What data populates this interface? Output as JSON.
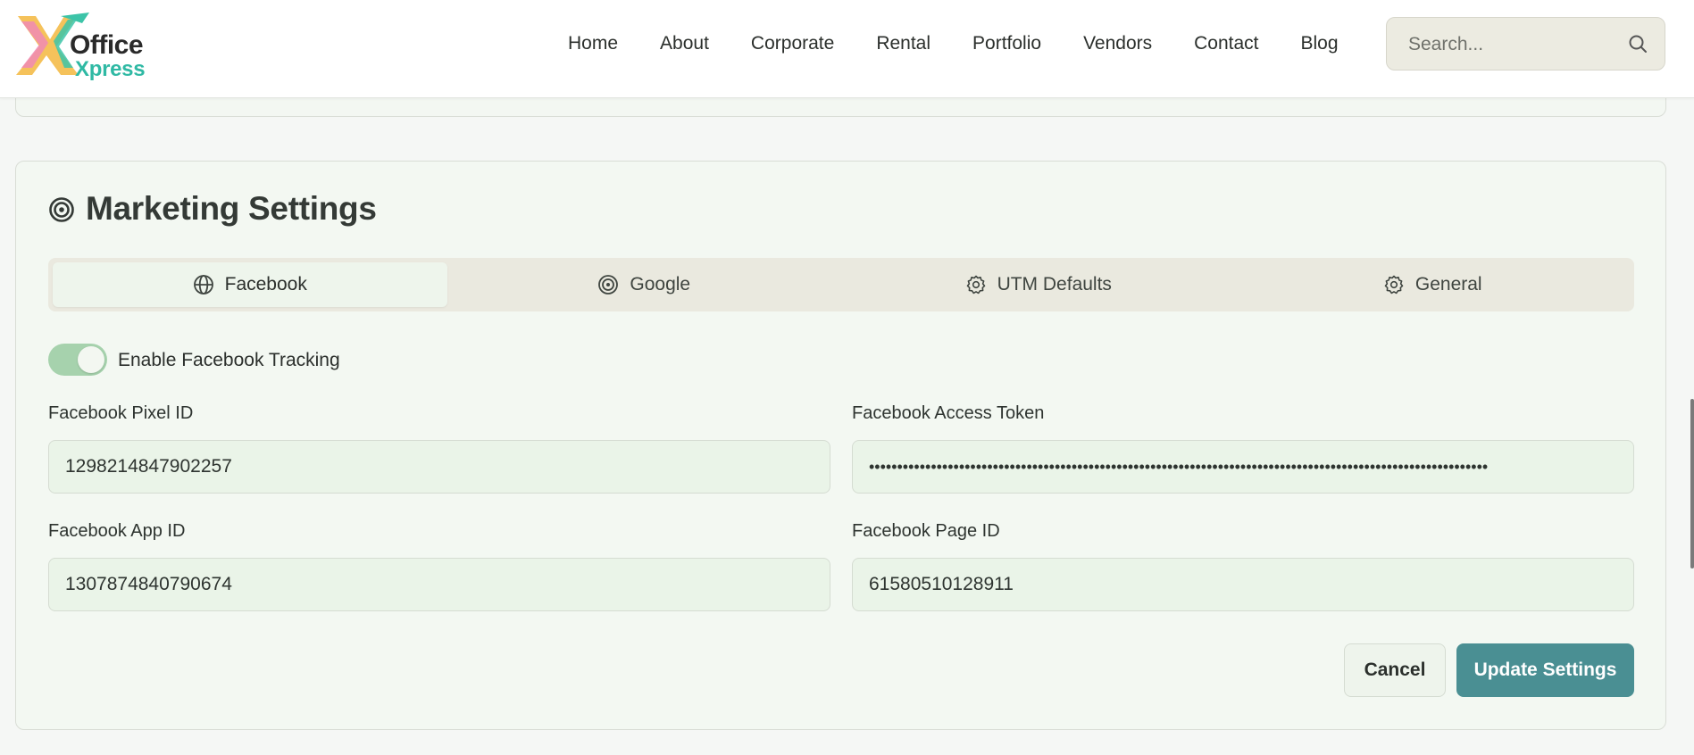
{
  "header": {
    "logo": {
      "line1": "Office",
      "line2": "Xpress"
    },
    "nav": [
      "Home",
      "About",
      "Corporate",
      "Rental",
      "Portfolio",
      "Vendors",
      "Contact",
      "Blog"
    ],
    "search_placeholder": "Search..."
  },
  "marketing": {
    "title": "Marketing Settings",
    "tabs": [
      {
        "label": "Facebook",
        "icon": "globe-icon",
        "active": true
      },
      {
        "label": "Google",
        "icon": "target-icon",
        "active": false
      },
      {
        "label": "UTM Defaults",
        "icon": "gear-icon",
        "active": false
      },
      {
        "label": "General",
        "icon": "gear-icon",
        "active": false
      }
    ],
    "toggle": {
      "label": "Enable Facebook Tracking",
      "enabled": true
    },
    "fields": {
      "pixel_id": {
        "label": "Facebook Pixel ID",
        "value": "1298214847902257"
      },
      "access_token": {
        "label": "Facebook Access Token",
        "value": "••••••••••••••••••••••••••••••••••••••••••••••••••••••••••••••••••••••••••••••••••••••••••••••••••••••••••••••"
      },
      "app_id": {
        "label": "Facebook App ID",
        "value": "1307874840790674"
      },
      "page_id": {
        "label": "Facebook Page ID",
        "value": "61580510128911"
      }
    },
    "buttons": {
      "cancel": "Cancel",
      "update": "Update Settings"
    }
  },
  "colors": {
    "accent": "#4a8f93",
    "toggle_on": "#a6d2ad",
    "logo_green": "#2fb9a4"
  }
}
